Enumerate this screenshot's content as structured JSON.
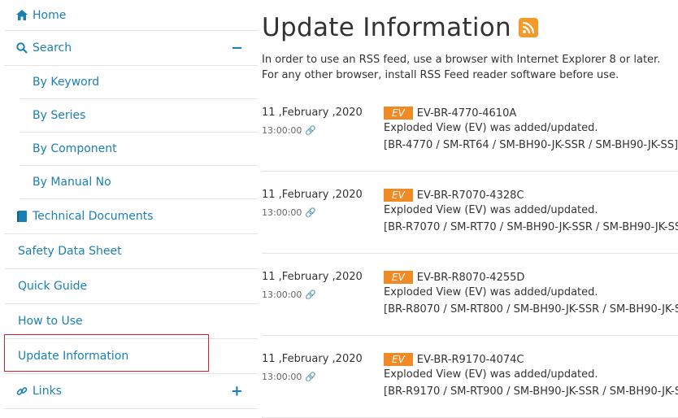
{
  "sidebar": {
    "home": "Home",
    "search": "Search",
    "search_toggle": "−",
    "search_items": [
      "By Keyword",
      "By Series",
      "By Component",
      "By Manual No"
    ],
    "technical": "Technical Documents",
    "safety": "Safety Data Sheet",
    "quick": "Quick Guide",
    "howto": "How to Use",
    "update": "Update Information",
    "links": "Links",
    "links_toggle": "+"
  },
  "main": {
    "title": "Update Information",
    "intro_line1": "In order to use an RSS feed, use a browser with Internet Explorer 8 or later.",
    "intro_line2": "For any other browser, install RSS Feed reader software before use.",
    "entries": [
      {
        "date": "11 ,February ,2020",
        "time": "13:00:00",
        "badge": "EV",
        "code": "EV-BR-4770-4610A",
        "desc": "Exploded View (EV) was added/updated.",
        "models": "[BR-4770 / SM-RT64 / SM-BH90-JK-SSR / SM-BH90-JK-SS]"
      },
      {
        "date": "11 ,February ,2020",
        "time": "13:00:00",
        "badge": "EV",
        "code": "EV-BR-R7070-4328C",
        "desc": "Exploded View (EV) was added/updated.",
        "models": "[BR-R7070 / SM-RT70 / SM-BH90-JK-SSR / SM-BH90-JK-SS"
      },
      {
        "date": "11 ,February ,2020",
        "time": "13:00:00",
        "badge": "EV",
        "code": "EV-BR-R8070-4255D",
        "desc": "Exploded View (EV) was added/updated.",
        "models": "[BR-R8070 / SM-RT800 / SM-BH90-JK-SSR / SM-BH90-JK-S"
      },
      {
        "date": "11 ,February ,2020",
        "time": "13:00:00",
        "badge": "EV",
        "code": "EV-BR-R9170-4074C",
        "desc": "Exploded View (EV) was added/updated.",
        "models": "[BR-R9170 / SM-RT900 / SM-BH90-JK-SSR / SM-BH90-JK-S"
      }
    ]
  },
  "colors": {
    "link": "#1a7fb4",
    "badge": "#f08a24",
    "rss": "#f39a2b",
    "highlight": "#d21f2b"
  }
}
